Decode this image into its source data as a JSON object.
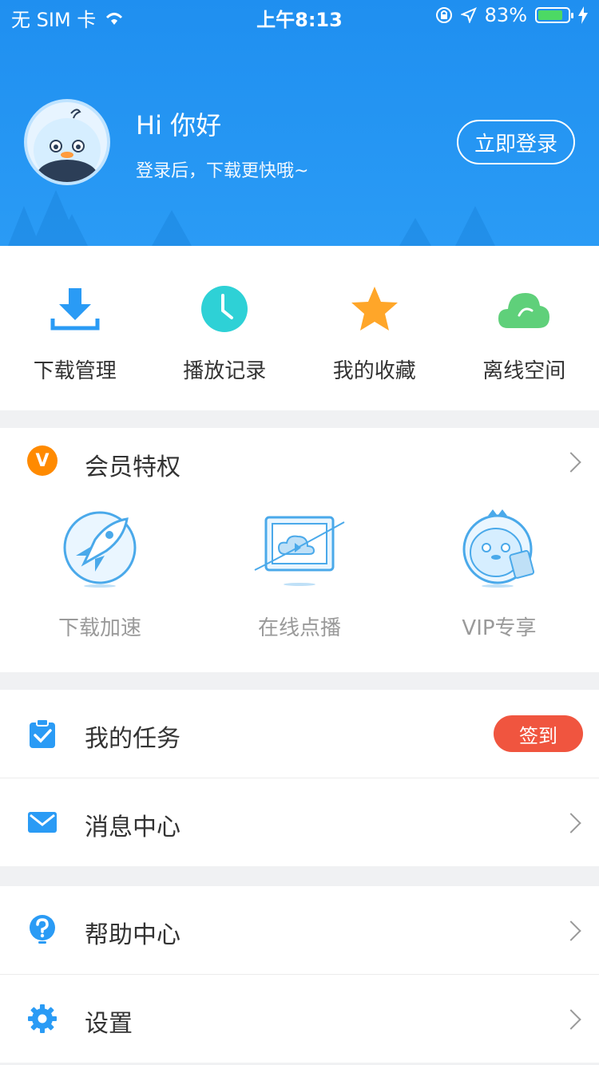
{
  "status_bar": {
    "carrier": "无 SIM 卡",
    "time": "上午8:13",
    "battery_percent": "83%",
    "battery_level": 0.83
  },
  "header": {
    "greeting": "Hi 你好",
    "subtitle": "登录后，下载更快哦~",
    "login_button": "立即登录",
    "bg_color": "#1f8ff0"
  },
  "shortcuts": [
    {
      "label": "下载管理",
      "icon": "download-icon",
      "color": "#2a9bf5"
    },
    {
      "label": "播放记录",
      "icon": "clock-icon",
      "color": "#2ed1d6"
    },
    {
      "label": "我的收藏",
      "icon": "star-icon",
      "color": "#ffa629"
    },
    {
      "label": "离线空间",
      "icon": "cloud-icon",
      "color": "#5fd07a"
    }
  ],
  "member": {
    "badge": "V",
    "title": "会员特权",
    "perks": [
      {
        "label": "下载加速",
        "icon": "rocket-icon"
      },
      {
        "label": "在线点播",
        "icon": "tv-play-icon"
      },
      {
        "label": "VIP专享",
        "icon": "vip-mascot-icon"
      }
    ]
  },
  "list_group_1": [
    {
      "label": "我的任务",
      "icon": "clipboard-check-icon",
      "action": "签到"
    },
    {
      "label": "消息中心",
      "icon": "mail-icon"
    }
  ],
  "list_group_2": [
    {
      "label": "帮助中心",
      "icon": "help-icon"
    },
    {
      "label": "设置",
      "icon": "gear-icon"
    }
  ]
}
